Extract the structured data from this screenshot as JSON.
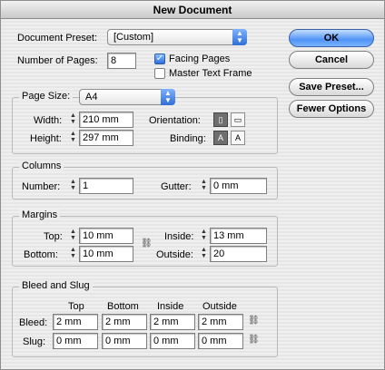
{
  "window": {
    "title": "New Document"
  },
  "doc_preset": {
    "label": "Document Preset:",
    "value": "[Custom]"
  },
  "num_pages": {
    "label": "Number of Pages:",
    "value": "8"
  },
  "facing_pages": {
    "label": "Facing Pages",
    "checked": true
  },
  "master_text_frame": {
    "label": "Master Text Frame",
    "checked": false
  },
  "buttons": {
    "ok": "OK",
    "cancel": "Cancel",
    "save_preset": "Save Preset...",
    "fewer_options": "Fewer Options"
  },
  "page_size": {
    "group_label": "Page Size:",
    "value": "A4",
    "width_label": "Width:",
    "width": "210 mm",
    "height_label": "Height:",
    "height": "297 mm",
    "orientation_label": "Orientation:",
    "binding_label": "Binding:"
  },
  "columns": {
    "group_label": "Columns",
    "number_label": "Number:",
    "number": "1",
    "gutter_label": "Gutter:",
    "gutter": "0 mm"
  },
  "margins": {
    "group_label": "Margins",
    "top_label": "Top:",
    "top": "10 mm",
    "bottom_label": "Bottom:",
    "bottom": "10 mm",
    "inside_label": "Inside:",
    "inside": "13 mm",
    "outside_label": "Outside:",
    "outside": "20"
  },
  "bleed_slug": {
    "group_label": "Bleed and Slug",
    "col_headers": [
      "Top",
      "Bottom",
      "Inside",
      "Outside"
    ],
    "bleed_label": "Bleed:",
    "bleed": [
      "2 mm",
      "2 mm",
      "2 mm",
      "2 mm"
    ],
    "slug_label": "Slug:",
    "slug": [
      "0 mm",
      "0 mm",
      "0 mm",
      "0 mm"
    ]
  },
  "icons": {
    "spinner": "stepper-arrows-icon",
    "chain": "link-chain-icon",
    "portrait": "portrait-icon",
    "landscape": "landscape-icon",
    "binding_left": "left-binding-icon",
    "binding_right": "right-binding-icon"
  }
}
